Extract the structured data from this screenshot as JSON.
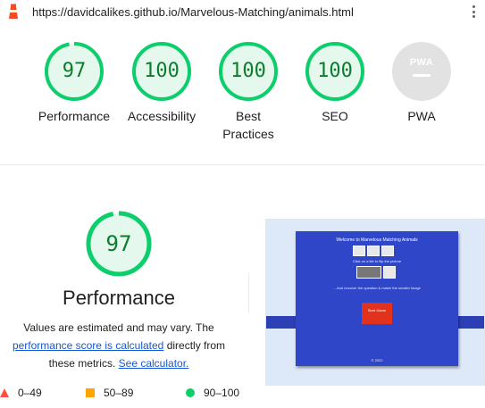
{
  "browser": {
    "url": "https://davidcalikes.github.io/Marvelous-Matching/animals.html"
  },
  "gauges": [
    {
      "score": "97",
      "label": "Performance"
    },
    {
      "score": "100",
      "label": "Accessibility"
    },
    {
      "score": "100",
      "label": "Best Practices"
    },
    {
      "score": "100",
      "label": "SEO"
    }
  ],
  "pwa": {
    "badge": "PWA",
    "label": "PWA"
  },
  "performance": {
    "score": "97",
    "title": "Performance",
    "desc_prefix": "Values are estimated and may vary. The",
    "score_link": "performance score is calculated",
    "desc_middle": "directly from these metrics.",
    "calc_link": "See calculator."
  },
  "legend": {
    "fail": "0–49",
    "average": "50–89",
    "pass": "90–100"
  },
  "colors": {
    "pass": "#0cce6b",
    "pass_text": "#0c7d2c",
    "average": "#ffa400",
    "fail": "#ff4e42",
    "link": "#1558d6"
  },
  "screenshot": {
    "title": "Welcome to Marvelous Matching Animals",
    "line1": "Click on a tile to flip the picture",
    "line2": "…And uncover the question & match the smaller image",
    "button": "Start Game",
    "footer": "© 2022"
  }
}
